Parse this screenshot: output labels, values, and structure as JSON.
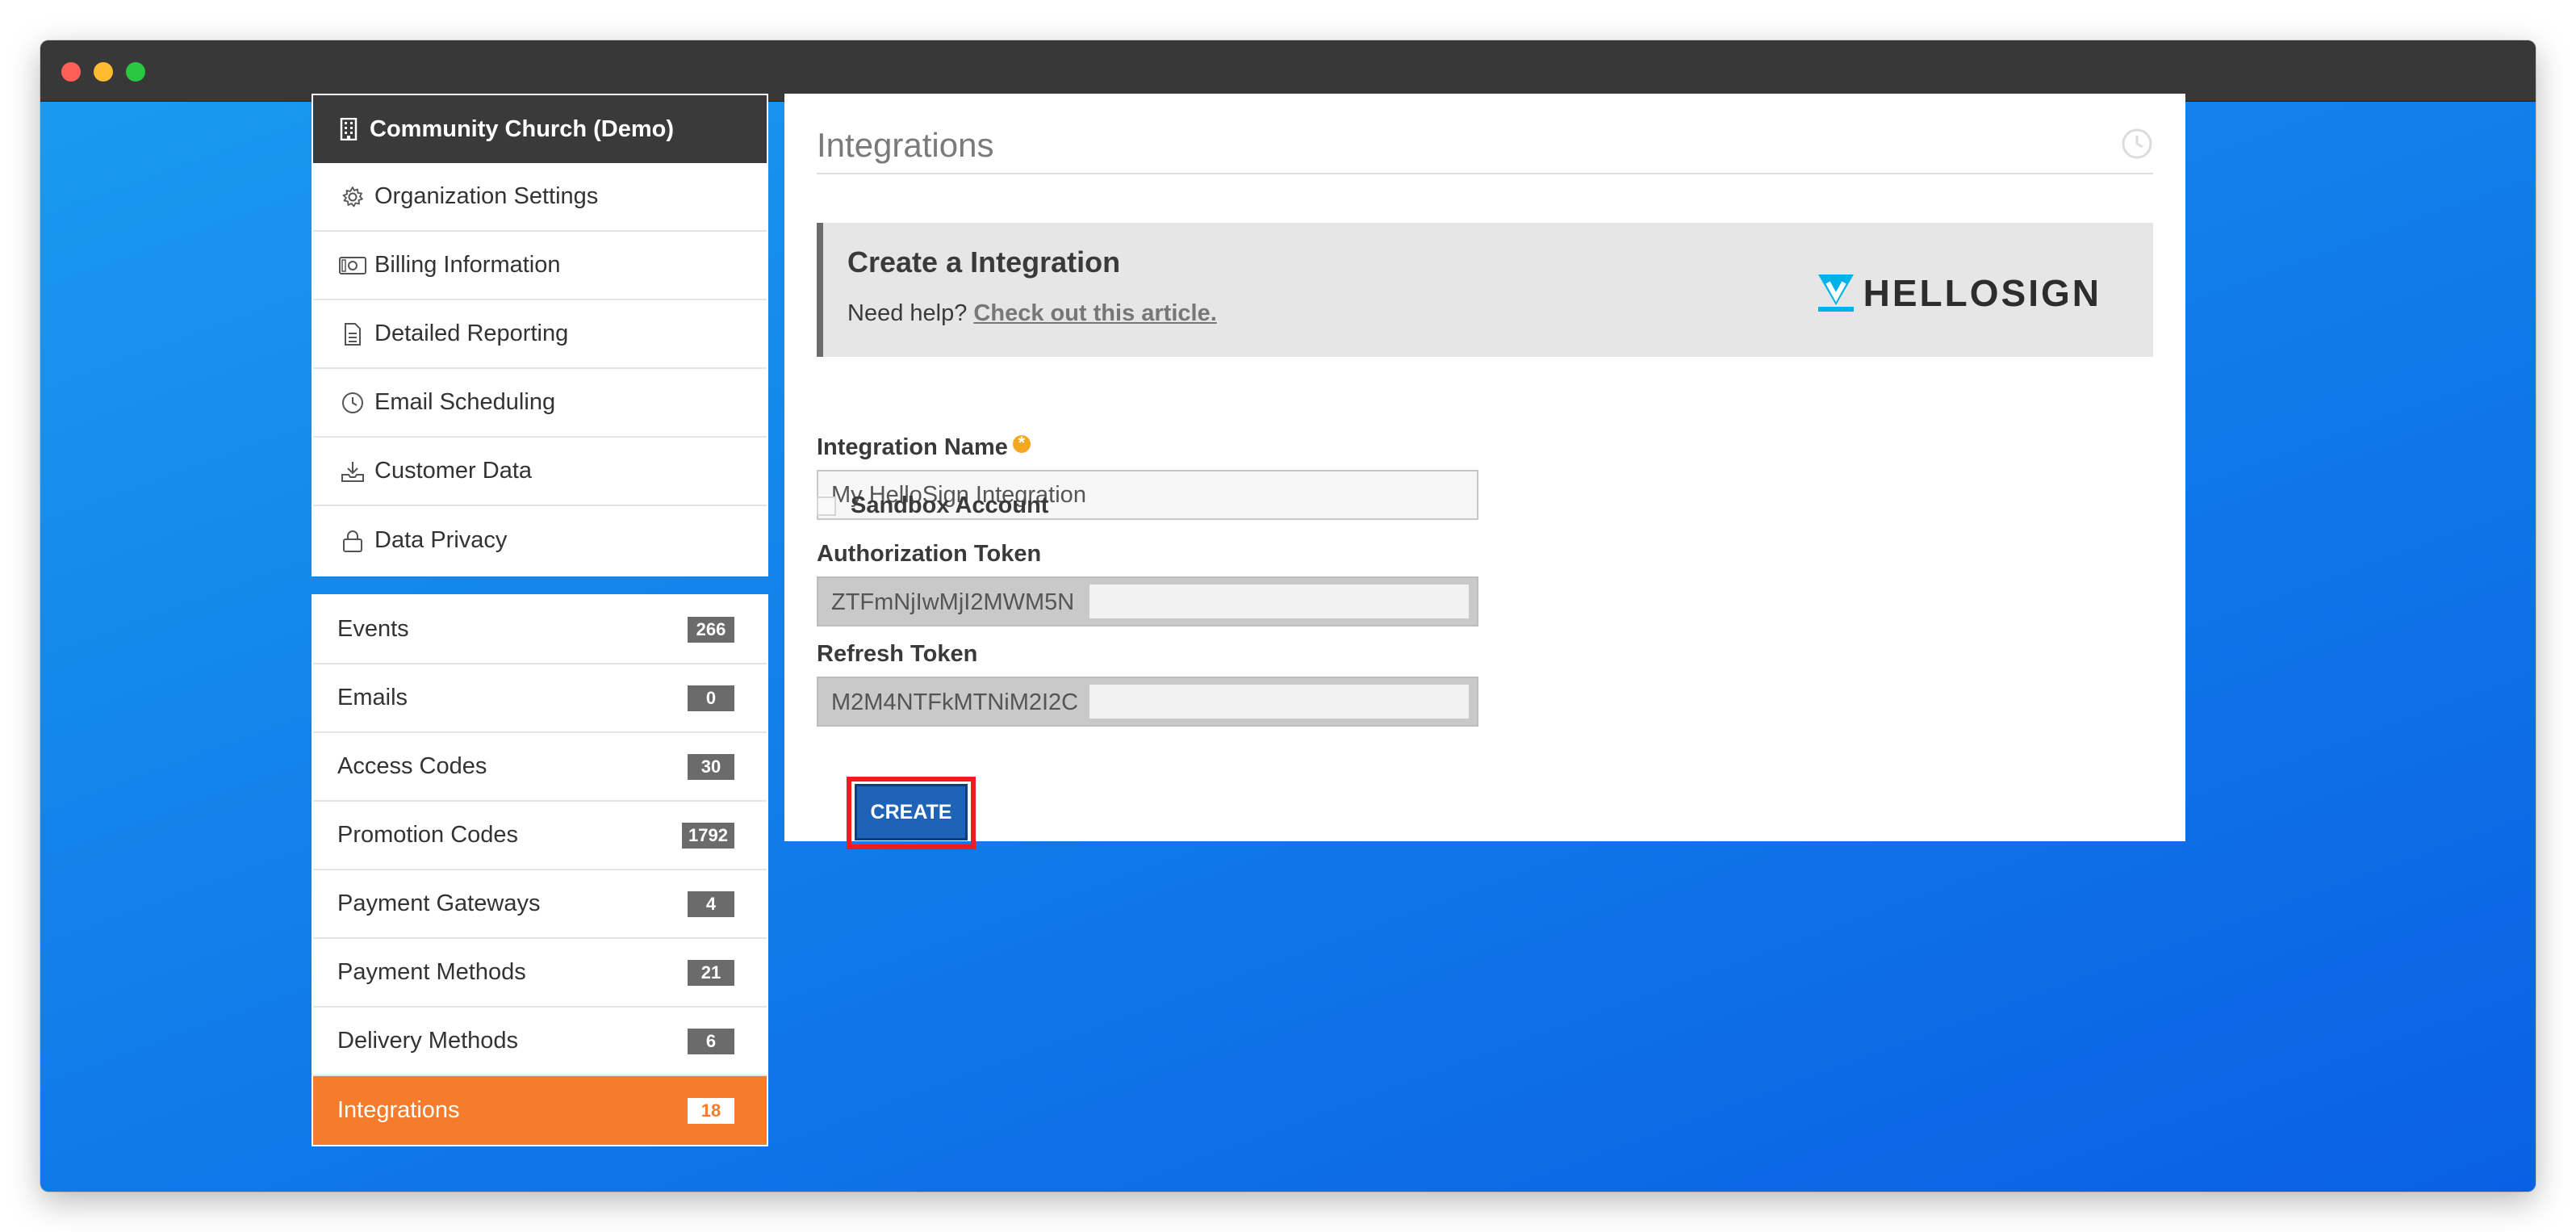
{
  "sidebar": {
    "org_name": "Community Church (Demo)",
    "org_items": [
      {
        "label": "Organization Settings",
        "icon": "gear-icon"
      },
      {
        "label": "Billing Information",
        "icon": "money-icon"
      },
      {
        "label": "Detailed Reporting",
        "icon": "document-icon"
      },
      {
        "label": "Email Scheduling",
        "icon": "clock-icon"
      },
      {
        "label": "Customer Data",
        "icon": "download-icon"
      },
      {
        "label": "Data Privacy",
        "icon": "lock-icon"
      }
    ],
    "resources": [
      {
        "label": "Events",
        "count": "266"
      },
      {
        "label": "Emails",
        "count": "0"
      },
      {
        "label": "Access Codes",
        "count": "30"
      },
      {
        "label": "Promotion Codes",
        "count": "1792"
      },
      {
        "label": "Payment Gateways",
        "count": "4"
      },
      {
        "label": "Payment Methods",
        "count": "21"
      },
      {
        "label": "Delivery Methods",
        "count": "6"
      },
      {
        "label": "Integrations",
        "count": "18",
        "active": true
      }
    ]
  },
  "main": {
    "title": "Integrations",
    "banner": {
      "title": "Create a Integration",
      "help_prefix": "Need help?",
      "help_link": "Check out this article.",
      "logo_text": "HELLOSIGN"
    },
    "form": {
      "name_label": "Integration Name",
      "name_value": "My HelloSign Integration",
      "sandbox_label": "Sandbox Account",
      "auth_label": "Authorization Token",
      "auth_value": "ZTFmNjIwMjI2MWM5N",
      "refresh_label": "Refresh Token",
      "refresh_value": "M2M4NTFkMTNiM2I2C",
      "create_label": "CREATE"
    }
  },
  "colors": {
    "accent_orange": "#f47c2c",
    "button_blue": "#1e63b8",
    "highlight_red": "#ee1c1c",
    "hellosign_teal": "#00b3e6"
  }
}
